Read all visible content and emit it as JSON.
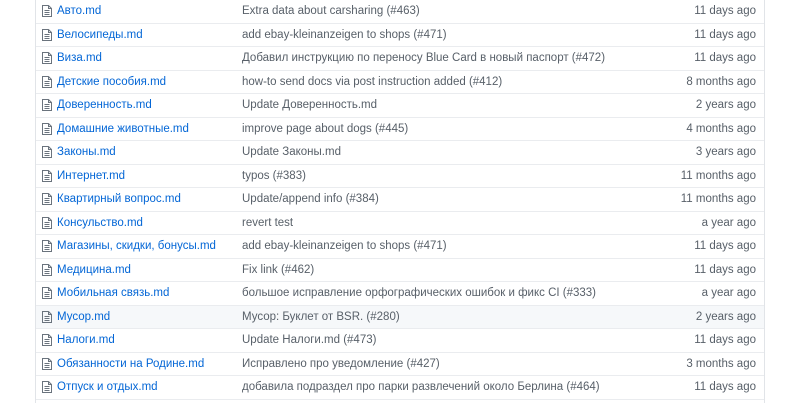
{
  "file_list": {
    "rows": [
      {
        "name": "Авто.md",
        "message": "Extra data about carsharing (#463)",
        "age": "11 days ago"
      },
      {
        "name": "Велосипеды.md",
        "message": "add ebay-kleinanzeigen to shops (#471)",
        "age": "11 days ago"
      },
      {
        "name": "Виза.md",
        "message": "Добавил инструкцию по переносу Blue Card в новый паспорт (#472)",
        "age": "11 days ago"
      },
      {
        "name": "Детские пособия.md",
        "message": "how-to send docs via post instruction added (#412)",
        "age": "8 months ago"
      },
      {
        "name": "Доверенность.md",
        "message": "Update Доверенность.md",
        "age": "2 years ago"
      },
      {
        "name": "Домашние животные.md",
        "message": "improve page about dogs (#445)",
        "age": "4 months ago"
      },
      {
        "name": "Законы.md",
        "message": "Update Законы.md",
        "age": "3 years ago"
      },
      {
        "name": "Интернет.md",
        "message": "typos (#383)",
        "age": "11 months ago"
      },
      {
        "name": "Квартирный вопрос.md",
        "message": "Update/append info (#384)",
        "age": "11 months ago"
      },
      {
        "name": "Консульство.md",
        "message": "revert test",
        "age": "a year ago"
      },
      {
        "name": "Магазины, скидки, бонусы.md",
        "message": "add ebay-kleinanzeigen to shops (#471)",
        "age": "11 days ago"
      },
      {
        "name": "Медицина.md",
        "message": "Fix link (#462)",
        "age": "11 days ago"
      },
      {
        "name": "Мобильная связь.md",
        "message": "большое исправление орфографических ошибок и фикс CI (#333)",
        "age": "a year ago"
      },
      {
        "name": "Мусор.md",
        "message": "Мусор: Буклет от BSR. (#280)",
        "age": "2 years ago",
        "highlighted": true
      },
      {
        "name": "Налоги.md",
        "message": "Update Налоги.md (#473)",
        "age": "11 days ago"
      },
      {
        "name": "Обязанности на Родине.md",
        "message": "Исправлено про уведомление (#427)",
        "age": "3 months ago"
      },
      {
        "name": "Отпуск и отдых.md",
        "message": "добавила подраздел про парки развлечений около Берлина (#464)",
        "age": "11 days ago"
      }
    ],
    "icon": "file-text-icon",
    "colors": {
      "link": "#0366d6",
      "muted_text": "#586069",
      "row_border": "#eaecef",
      "highlight_bg": "#f6f8fa"
    }
  }
}
